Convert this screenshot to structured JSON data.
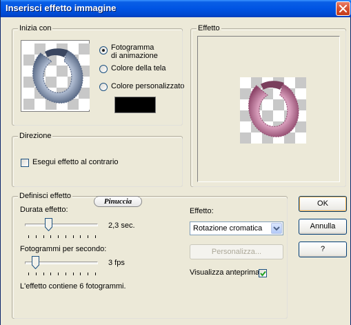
{
  "window": {
    "title": "Inserisci effetto immagine"
  },
  "start_group": {
    "legend": "Inizia con",
    "options": [
      {
        "label_line1": "Fotogramma",
        "label_line2": "di animazione",
        "selected": true
      },
      {
        "label_line1": "Colore della tela",
        "selected": false
      },
      {
        "label_line1": "Colore personalizzato",
        "selected": false
      }
    ],
    "custom_color": "#000000"
  },
  "preview_group": {
    "legend": "Effetto"
  },
  "direction_group": {
    "legend": "Direzione",
    "reverse_label": "Esegui effetto al contrario",
    "reverse_checked": false
  },
  "define_group": {
    "legend": "Definisci effetto",
    "watermark": "Pinuccia",
    "duration_label": "Durata effetto:",
    "duration_value": "2,3 sec.",
    "duration_level": 0.3,
    "fps_label": "Fotogrammi per secondo:",
    "fps_value": "3 fps",
    "fps_level": 0.1,
    "frames_info": "L'effetto contiene 6 fotogrammi.",
    "effect_label": "Effetto:",
    "effect_selected": "Rotazione cromatica",
    "customize_label": "Personalizza...",
    "show_preview_label": "Visualizza anteprima",
    "show_preview_checked": true
  },
  "buttons": {
    "ok": "OK",
    "cancel": "Annulla",
    "help": "?"
  },
  "colors": {
    "accent": "#0054e3",
    "close": "#d5502f",
    "gray_fur": "#8a9bb5",
    "pink_fur": "#c787a8"
  }
}
